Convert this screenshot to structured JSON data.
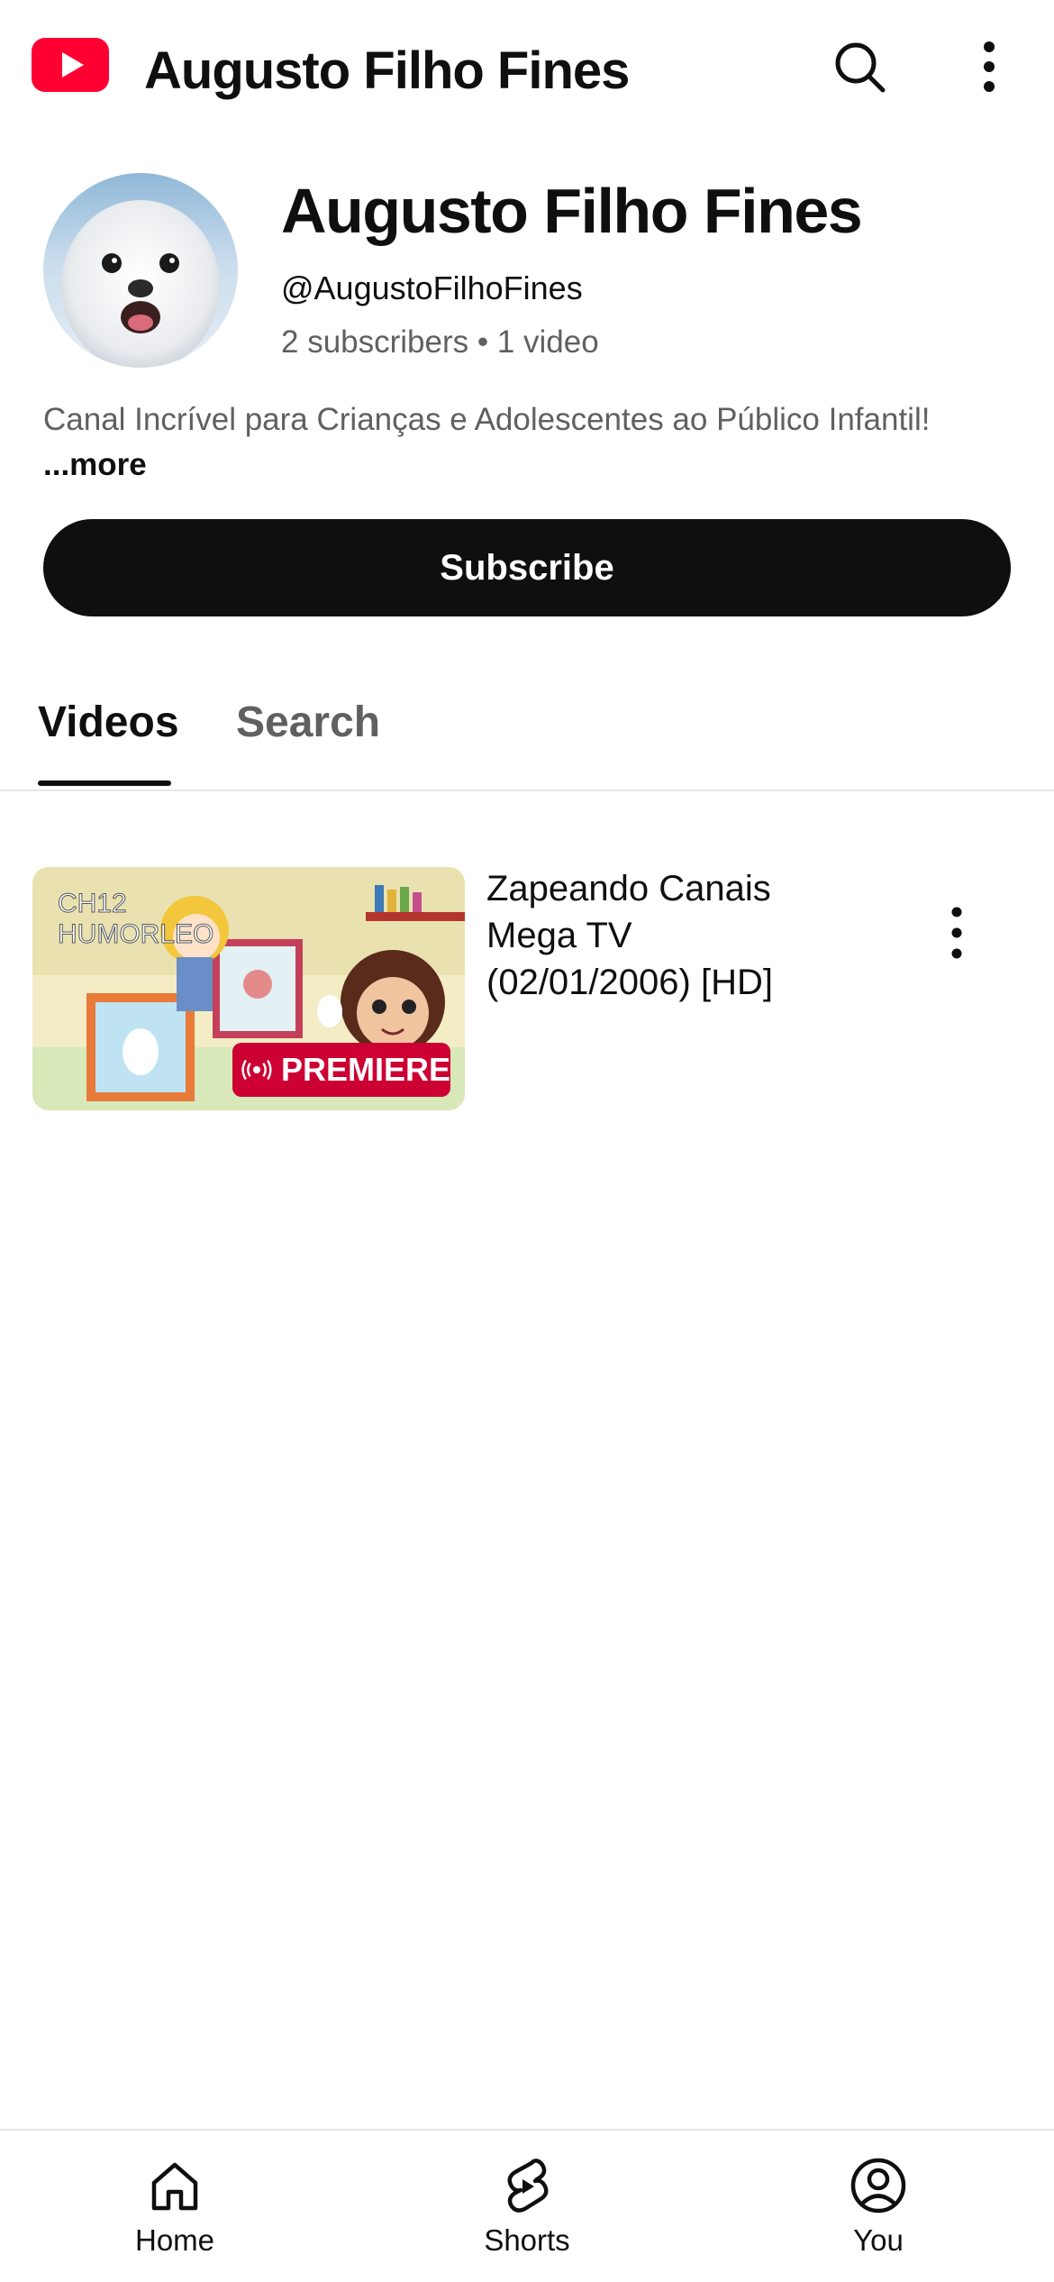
{
  "app": {
    "title": "Augusto Filho Fines",
    "brand_color": "#ff0033"
  },
  "topbar": {
    "logo_icon": "youtube-logo-icon",
    "title": "Augusto Filho Fines",
    "actions": [
      "search-icon",
      "more-vert-icon"
    ]
  },
  "channel": {
    "name": "Augusto Filho Fines",
    "handle": "@AugustoFilhoFines",
    "stats": "2 subscribers • 1 video",
    "description": "Canal Incrível para Crianças e Adolescentes ao Público Infantil!",
    "more_label": "...more",
    "subscribe_label": "Subscribe"
  },
  "tabs": [
    {
      "label": "Videos",
      "selected": true
    },
    {
      "label": "Search",
      "selected": false
    }
  ],
  "videos": [
    {
      "title": "Zapeando Canais Mega TV (02/01/2006) [HD]",
      "thumbnail_text": "CH12 HUMORLEO",
      "badge": "PREMIERE",
      "badge_color": "#cc0033"
    }
  ],
  "bottom_nav": [
    {
      "label": "Home",
      "icon": "home-icon"
    },
    {
      "label": "Shorts",
      "icon": "shorts-icon"
    },
    {
      "label": "You",
      "icon": "account-circle-icon"
    }
  ]
}
